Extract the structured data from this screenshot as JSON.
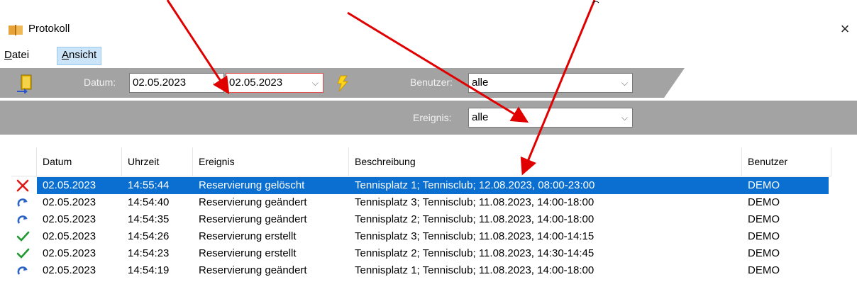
{
  "window": {
    "title": "Protokoll",
    "close_glyph": "×"
  },
  "menubar": {
    "items": [
      {
        "accel": "D",
        "rest": "atei"
      },
      {
        "accel": "A",
        "rest": "nsicht"
      }
    ]
  },
  "filters": {
    "datum_label": "Datum:",
    "date_from": "02.05.2023",
    "date_to": "02.05.2023",
    "benutzer_label": "Benutzer:",
    "benutzer_value": "alle",
    "ereignis_label": "Ereignis:",
    "ereignis_value": "alle"
  },
  "table": {
    "columns": [
      "Datum",
      "Uhrzeit",
      "Ereignis",
      "Beschreibung",
      "Benutzer"
    ],
    "rows": [
      {
        "icon": "delete-x-icon",
        "datum": "02.05.2023",
        "uhrzeit": "14:55:44",
        "ereignis": "Reservierung gelöscht",
        "beschreibung": "Tennisplatz 1; Tennisclub; 12.08.2023, 08:00-23:00",
        "benutzer": "DEMO"
      },
      {
        "icon": "refresh-arrow-icon",
        "datum": "02.05.2023",
        "uhrzeit": "14:54:40",
        "ereignis": "Reservierung geändert",
        "beschreibung": "Tennisplatz 3; Tennisclub; 11.08.2023, 14:00-18:00",
        "benutzer": "DEMO"
      },
      {
        "icon": "refresh-arrow-icon",
        "datum": "02.05.2023",
        "uhrzeit": "14:54:35",
        "ereignis": "Reservierung geändert",
        "beschreibung": "Tennisplatz 2; Tennisclub; 11.08.2023, 14:00-18:00",
        "benutzer": "DEMO"
      },
      {
        "icon": "checkmark-icon",
        "datum": "02.05.2023",
        "uhrzeit": "14:54:26",
        "ereignis": "Reservierung erstellt",
        "beschreibung": "Tennisplatz 3; Tennisclub; 11.08.2023, 14:00-14:15",
        "benutzer": "DEMO"
      },
      {
        "icon": "checkmark-icon",
        "datum": "02.05.2023",
        "uhrzeit": "14:54:23",
        "ereignis": "Reservierung erstellt",
        "beschreibung": "Tennisplatz 2; Tennisclub; 11.08.2023, 14:30-14:45",
        "benutzer": "DEMO"
      },
      {
        "icon": "refresh-arrow-icon",
        "datum": "02.05.2023",
        "uhrzeit": "14:54:19",
        "ereignis": "Reservierung geändert",
        "beschreibung": "Tennisplatz 1; Tennisclub; 11.08.2023, 14:00-18:00",
        "benutzer": "DEMO"
      }
    ],
    "selected_row": 0
  },
  "colors": {
    "toolbar": "#a3a3a3",
    "selection": "#0a6fd0",
    "annotation_arrow": "#e00000"
  }
}
